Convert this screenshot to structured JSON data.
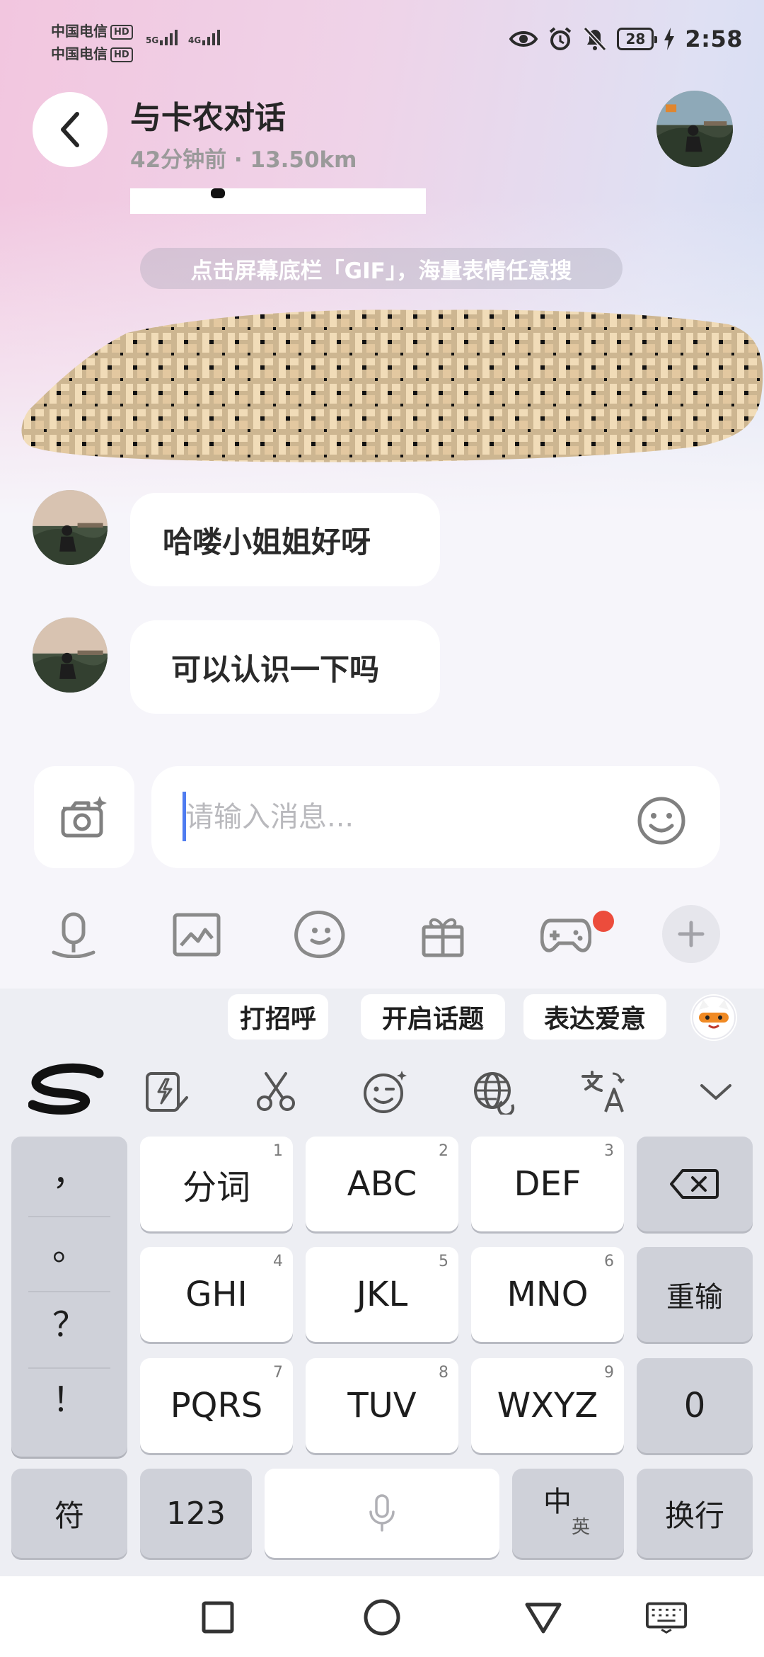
{
  "status_bar": {
    "carrier_1": "中国电信",
    "carrier_2": "中国电信",
    "hd_label": "HD",
    "net_1": "5G",
    "net_2": "4G",
    "battery": "28",
    "time": "2:58"
  },
  "header": {
    "title": "与卡农对话",
    "subtitle": "42分钟前 · 13.50km"
  },
  "chat": {
    "tip": "点击屏幕底栏「GIF」，海量表情任意搜",
    "messages": [
      {
        "text": "哈喽小姐姐好呀"
      },
      {
        "text": "可以认识一下吗"
      }
    ]
  },
  "composer": {
    "placeholder": "请输入消息..."
  },
  "keyboard": {
    "suggestions": [
      "打招呼",
      "开启话题",
      "表达爱意"
    ],
    "punctuation": [
      "，",
      "。",
      "？",
      "！"
    ],
    "keys": [
      {
        "label": "分词",
        "num": "1"
      },
      {
        "label": "ABC",
        "num": "2"
      },
      {
        "label": "DEF",
        "num": "3"
      },
      {
        "label": "GHI",
        "num": "4"
      },
      {
        "label": "JKL",
        "num": "5"
      },
      {
        "label": "MNO",
        "num": "6"
      },
      {
        "label": "PQRS",
        "num": "7"
      },
      {
        "label": "TUV",
        "num": "8"
      },
      {
        "label": "WXYZ",
        "num": "9"
      }
    ],
    "reset": "重输",
    "zero": "0",
    "symbols": "符",
    "numbers": "123",
    "lang_main": "中",
    "lang_sub": "英",
    "enter": "换行"
  }
}
